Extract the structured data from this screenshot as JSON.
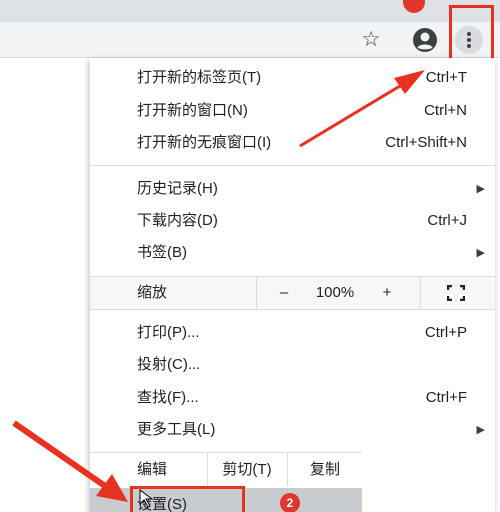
{
  "toolbar": {
    "star_glyph": "☆",
    "bookmark_icon": "star-outline-icon",
    "profile_icon": "account-circle-icon",
    "menu_icon": "kebab-vertical-icon"
  },
  "menu": {
    "new_tab": {
      "label": "打开新的标签页(T)",
      "shortcut": "Ctrl+T"
    },
    "new_window": {
      "label": "打开新的窗口(N)",
      "shortcut": "Ctrl+N"
    },
    "new_incognito": {
      "label": "打开新的无痕窗口(I)",
      "shortcut": "Ctrl+Shift+N"
    },
    "history": {
      "label": "历史记录(H)"
    },
    "downloads": {
      "label": "下载内容(D)",
      "shortcut": "Ctrl+J"
    },
    "bookmarks": {
      "label": "书签(B)"
    },
    "zoom": {
      "label": "缩放",
      "minus": "–",
      "level": "100%",
      "plus": "+"
    },
    "print": {
      "label": "打印(P)...",
      "shortcut": "Ctrl+P"
    },
    "cast": {
      "label": "投射(C)..."
    },
    "find": {
      "label": "查找(F)...",
      "shortcut": "Ctrl+F"
    },
    "more_tools": {
      "label": "更多工具(L)"
    },
    "edit": {
      "label": "编辑",
      "cut": "剪切(T)",
      "copy": "复制"
    },
    "settings": {
      "label": "设置(S)"
    },
    "submenu_arrow": "▶"
  },
  "annotations": {
    "step2_badge": "2",
    "highlight_color": "#e8321f"
  }
}
